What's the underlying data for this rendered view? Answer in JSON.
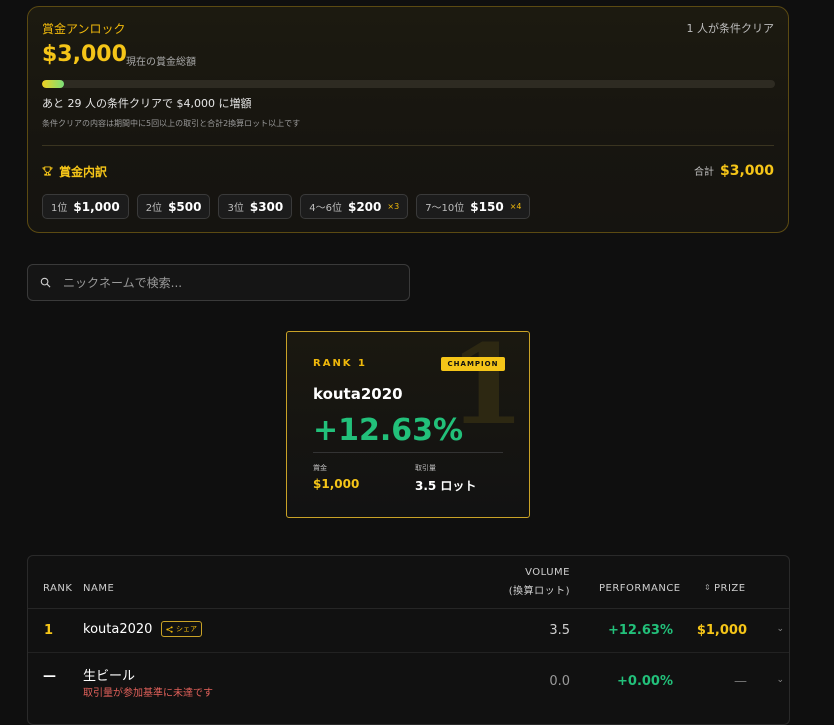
{
  "prize": {
    "unlock_label": "賞金アンロック",
    "clear_count": "1 人が条件クリア",
    "total_amount": "$3,000",
    "total_label": "現在の賞金総額",
    "progress": 0.03,
    "next_tier": "あと 29 人の条件クリアで $4,000 に増額",
    "condition_note": "条件クリアの内容は期間中に5回以上の取引と合計2換算ロット以上です",
    "breakdown_title": "賞金内訳",
    "sum_label": "合計",
    "sum_value": "$3,000",
    "tiers": [
      {
        "rank": "1位",
        "amount": "$1,000",
        "mult": ""
      },
      {
        "rank": "2位",
        "amount": "$500",
        "mult": ""
      },
      {
        "rank": "3位",
        "amount": "$300",
        "mult": ""
      },
      {
        "rank": "4〜6位",
        "amount": "$200",
        "mult": "×3"
      },
      {
        "rank": "7〜10位",
        "amount": "$150",
        "mult": "×4"
      }
    ]
  },
  "search": {
    "placeholder": "ニックネームで検索..."
  },
  "champion": {
    "watermark": "1",
    "rank_label": "RANK 1",
    "badge": "CHAMPION",
    "name": "kouta2020",
    "performance": "+12.63%",
    "prize_label": "賞金",
    "prize_value": "$1,000",
    "volume_label": "取引量",
    "volume_value": "3.5 ロット"
  },
  "table": {
    "headers": {
      "rank": "RANK",
      "name": "NAME",
      "volume_1": "VOLUME",
      "volume_2": "(換算ロット)",
      "performance": "PERFORMANCE",
      "prize_sort": "⇕",
      "prize": "PRIZE"
    },
    "rows": [
      {
        "rank": "1",
        "name": "kouta2020",
        "share": "シェア",
        "note": "",
        "volume": "3.5",
        "performance": "+12.63%",
        "prize": "$1,000"
      },
      {
        "rank": "—",
        "name": "生ビール",
        "share": "",
        "note": "取引量が参加基準に未達です",
        "volume": "0.0",
        "performance": "+0.00%",
        "prize": "—"
      }
    ]
  },
  "colors": {
    "accent": "#f5c518",
    "positive": "#22c07a",
    "warning": "#e0605a"
  }
}
